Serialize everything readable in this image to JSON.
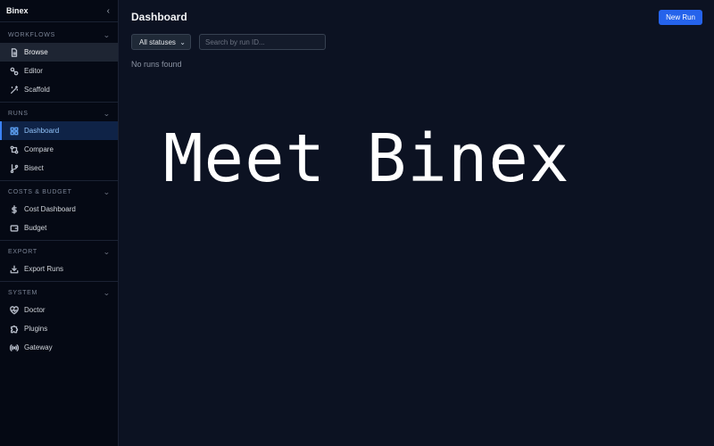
{
  "sidebar": {
    "brand": "Binex",
    "sections": [
      {
        "title": "WORKFLOWS",
        "items": [
          {
            "label": "Browse",
            "icon": "file-icon"
          },
          {
            "label": "Editor",
            "icon": "nodes-icon"
          },
          {
            "label": "Scaffold",
            "icon": "wand-icon"
          }
        ]
      },
      {
        "title": "RUNS",
        "items": [
          {
            "label": "Dashboard",
            "icon": "grid-icon"
          },
          {
            "label": "Compare",
            "icon": "compare-icon"
          },
          {
            "label": "Bisect",
            "icon": "git-branch-icon"
          }
        ]
      },
      {
        "title": "COSTS & BUDGET",
        "items": [
          {
            "label": "Cost Dashboard",
            "icon": "dollar-icon"
          },
          {
            "label": "Budget",
            "icon": "wallet-icon"
          }
        ]
      },
      {
        "title": "EXPORT",
        "items": [
          {
            "label": "Export Runs",
            "icon": "download-icon"
          }
        ]
      },
      {
        "title": "SYSTEM",
        "items": [
          {
            "label": "Doctor",
            "icon": "heart-pulse-icon"
          },
          {
            "label": "Plugins",
            "icon": "puzzle-icon"
          },
          {
            "label": "Gateway",
            "icon": "radio-icon"
          }
        ]
      }
    ]
  },
  "main": {
    "title": "Dashboard",
    "new_run_label": "New Run",
    "status_filter": "All statuses",
    "search_placeholder": "Search by run ID...",
    "empty_text": "No runs found"
  },
  "overlay_text": "Meet Binex",
  "colors": {
    "accent": "#2563eb",
    "background": "#0c1222",
    "sidebar": "#050914",
    "active_item": "#0f2347"
  }
}
